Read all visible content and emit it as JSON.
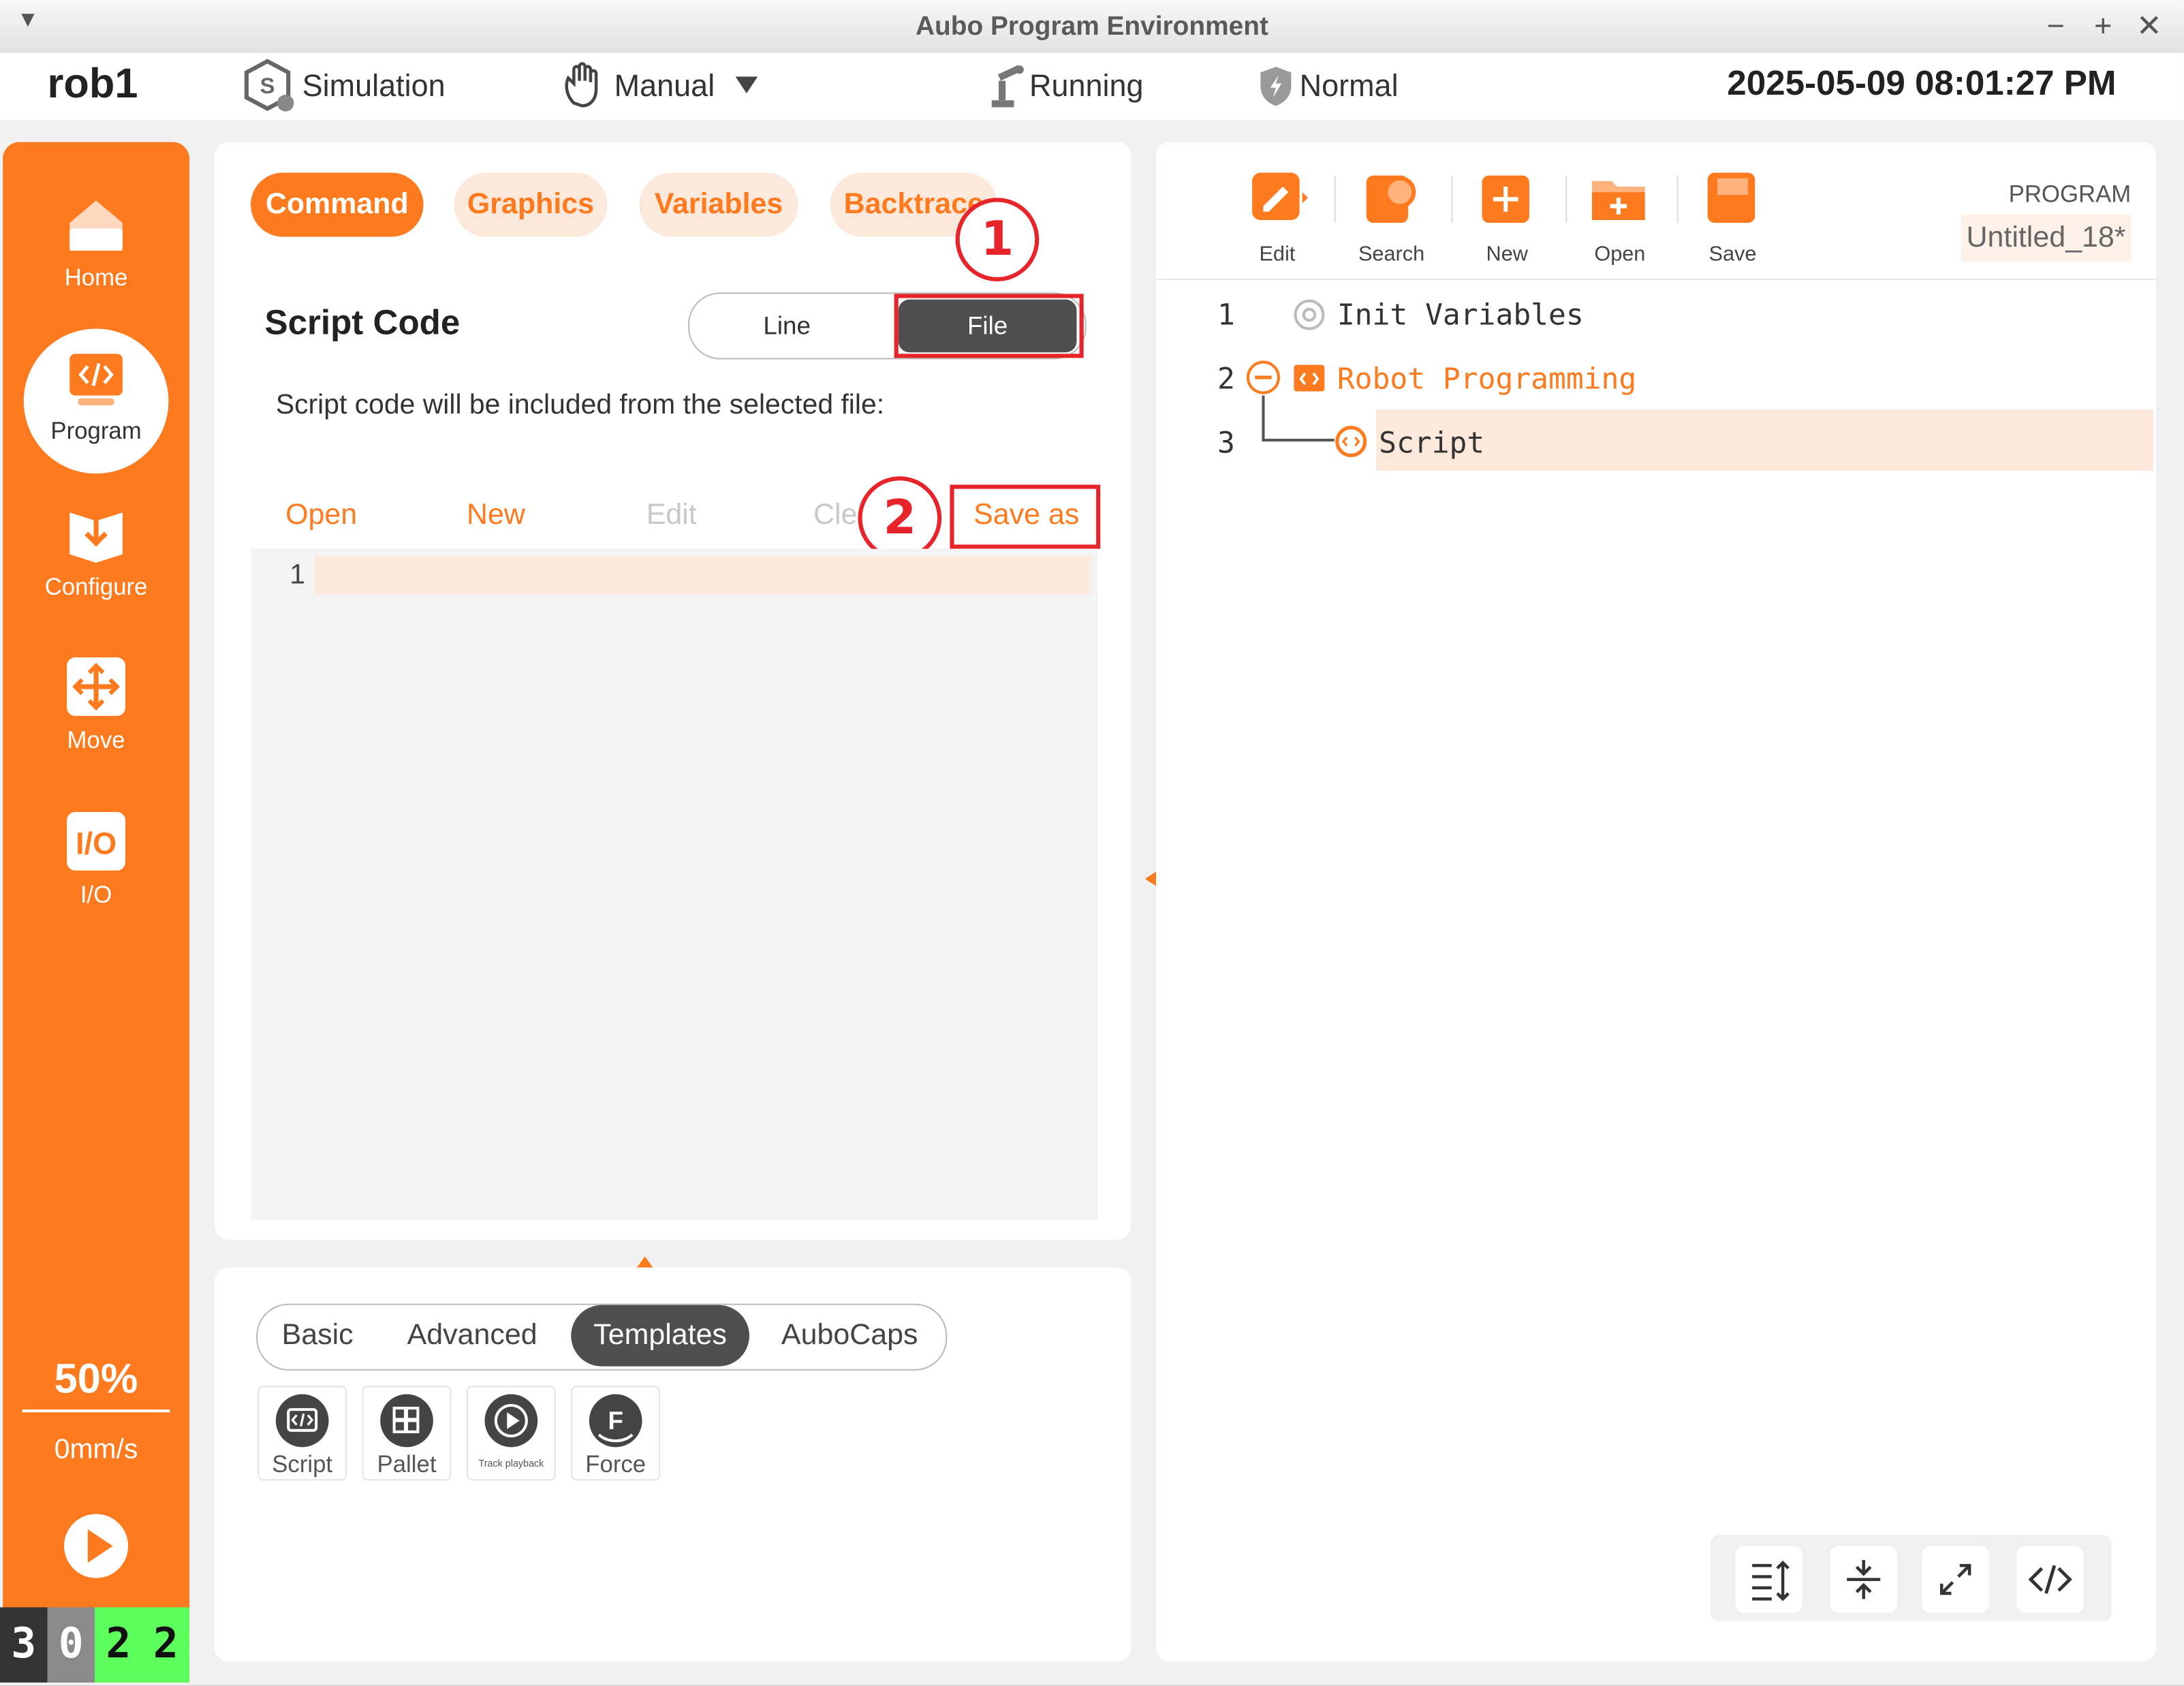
{
  "window": {
    "title": "Aubo Program Environment"
  },
  "status": {
    "robot": "rob1",
    "mode": "Simulation",
    "control": "Manual",
    "state": "Running",
    "safety": "Normal",
    "datetime": "2025-05-09 08:01:27 PM"
  },
  "nav": {
    "items": [
      {
        "label": "Home"
      },
      {
        "label": "Program"
      },
      {
        "label": "Configure"
      },
      {
        "label": "Move"
      },
      {
        "label": "I/O"
      }
    ],
    "speed_percent": "50%",
    "speed": "0mm/s",
    "counter": [
      "3",
      "0",
      "2",
      "2"
    ]
  },
  "command_panel": {
    "tabs": [
      "Command",
      "Graphics",
      "Variables",
      "Backtrace"
    ],
    "title": "Script Code",
    "toggle": {
      "line": "Line",
      "file": "File"
    },
    "description": "Script code will be included from the selected file:",
    "file_buttons": {
      "open": "Open",
      "new": "New",
      "edit": "Edit",
      "clear": "Cle",
      "save_as": "Save as"
    },
    "editor_line": "1",
    "callouts": [
      "1",
      "2"
    ]
  },
  "tool_panel": {
    "tabs": [
      "Basic",
      "Advanced",
      "Templates",
      "AuboCaps"
    ],
    "items": [
      {
        "label": "Script"
      },
      {
        "label": "Pallet"
      },
      {
        "label": "Track playback"
      },
      {
        "label": "Force"
      }
    ]
  },
  "program_panel": {
    "toolbar": [
      "Edit",
      "Search",
      "New",
      "Open",
      "Save"
    ],
    "program_label": "PROGRAM",
    "program_name": "Untitled_18*",
    "tree": [
      {
        "num": "1",
        "label": "Init Variables"
      },
      {
        "num": "2",
        "label": "Robot Programming"
      },
      {
        "num": "3",
        "label": "Script"
      }
    ]
  },
  "colors": {
    "accent": "#fd7b1e",
    "highlight": "#fde9db",
    "callout": "#e8242b",
    "counter_green": "#5cff5c"
  }
}
